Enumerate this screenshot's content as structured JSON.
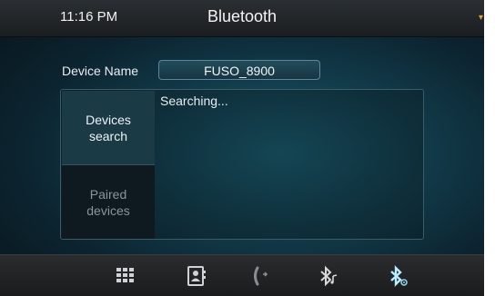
{
  "header": {
    "time": "11:16 PM",
    "title": "Bluetooth"
  },
  "device": {
    "label": "Device Name",
    "value": "FUSO_8900"
  },
  "tabs": [
    {
      "label_line1": "Devices",
      "label_line2": "search",
      "active": true
    },
    {
      "label_line1": "Paired",
      "label_line2": "devices",
      "active": false
    }
  ],
  "status": "Searching...",
  "dock": [
    {
      "icon": "grid-icon"
    },
    {
      "icon": "contacts-icon"
    },
    {
      "icon": "phone-icon"
    },
    {
      "icon": "bluetooth-audio-icon"
    },
    {
      "icon": "bluetooth-settings-icon",
      "active": true
    }
  ],
  "colors": {
    "accent": "#8fd3ea",
    "text": "#eef3f4"
  }
}
